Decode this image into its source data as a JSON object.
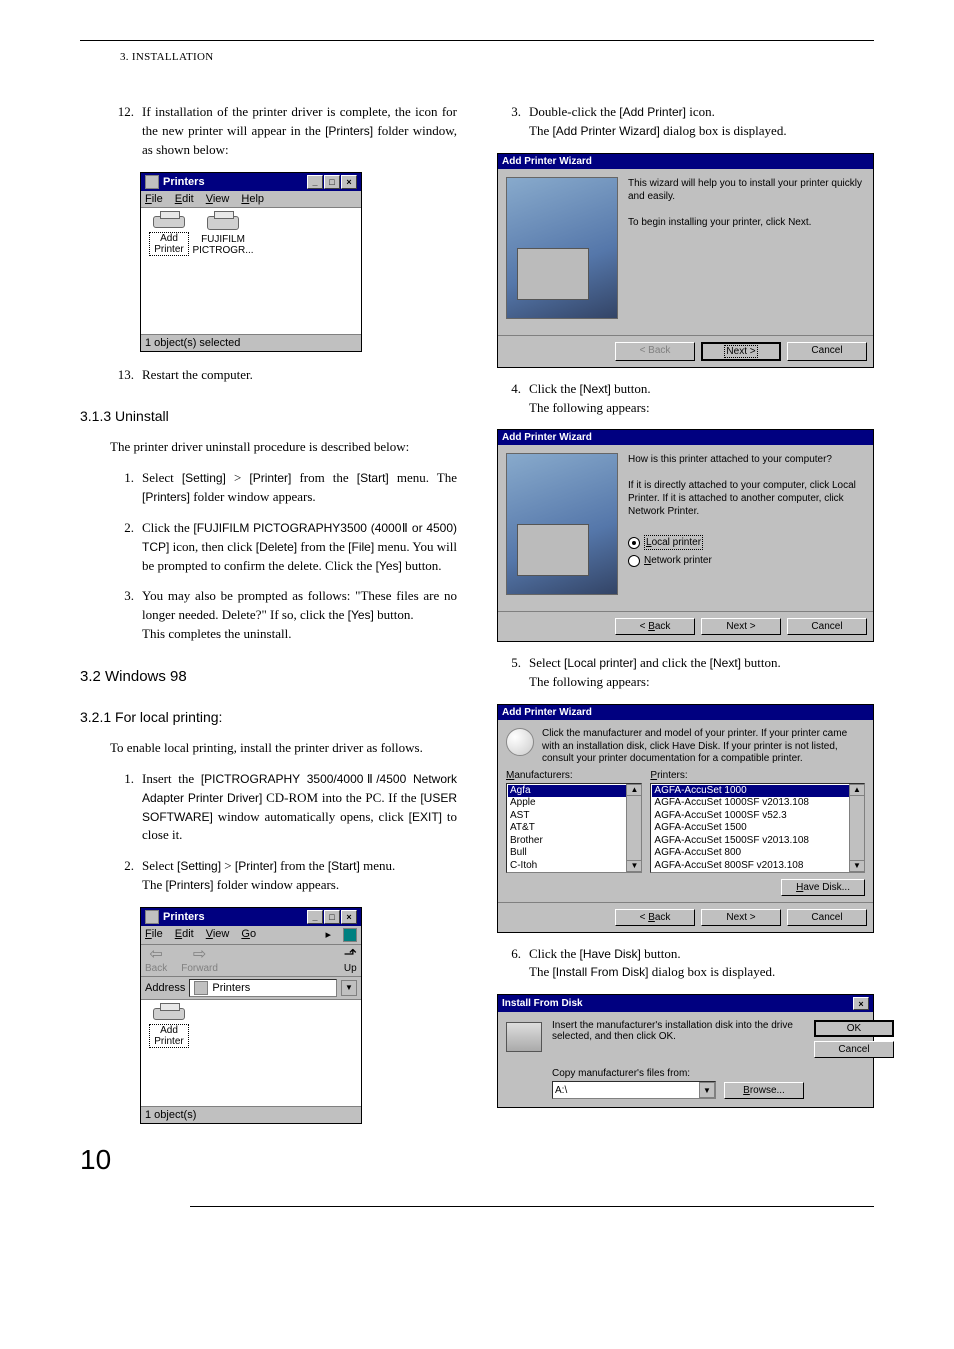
{
  "header": {
    "section": "3. INSTALLATION"
  },
  "left": {
    "step12_num": "12.",
    "step12_text_a": "If installation of the printer driver is complete, the icon for the new printer will appear in the ",
    "step12_ui": "[Printers]",
    "step12_text_b": " folder window, as shown below:",
    "printersWin": {
      "title": "Printers",
      "menu_file": "File",
      "menu_edit": "Edit",
      "menu_view": "View",
      "menu_help": "Help",
      "icon_add": "Add Printer",
      "icon_fuji": "FUJIFILM PICTROGR...",
      "status": "1 object(s) selected"
    },
    "step13_num": "13.",
    "step13_text": "Restart the computer.",
    "sec313": "3.1.3   Uninstall",
    "uninstall_intro": "The printer driver uninstall procedure is described below:",
    "u1_num": "1.",
    "u1_a": "Select ",
    "u1_ui1": "[Setting]",
    "u1_b": " > ",
    "u1_ui2": "[Printer]",
    "u1_c": " from the ",
    "u1_ui3": "[Start]",
    "u1_d": " menu. The ",
    "u1_ui4": "[Printers]",
    "u1_e": " folder window appears.",
    "u2_num": "2.",
    "u2_a": "Click the ",
    "u2_ui1": "[FUJIFILM PICTOGRAPHY3500 (4000Ⅱ or 4500) TCP]",
    "u2_b": " icon, then click ",
    "u2_ui2": "[Delete]",
    "u2_c": " from the ",
    "u2_ui3": "[File]",
    "u2_d": " menu. You will be prompted to confirm the delete. Click the ",
    "u2_ui4": "[Yes]",
    "u2_e": " button.",
    "u3_num": "3.",
    "u3_a": "You may also be prompted as follows: \"These files are no longer needed. Delete?\" If so, click the ",
    "u3_ui1": "[Yes]",
    "u3_b": " button.",
    "u3_c": "This completes the uninstall.",
    "sec32": "3.2   Windows 98",
    "sec321": "3.2.1   For local printing:",
    "local_intro": "To enable local printing, install the printer driver as follows.",
    "l1_num": "1.",
    "l1_a": "Insert the ",
    "l1_ui1": "[PICTROGRAPHY 3500/4000Ⅱ/4500 Network Adapter Printer Driver]",
    "l1_b": " CD-ROM into the PC. If the ",
    "l1_ui2": "[USER SOFTWARE]",
    "l1_c": " window automatically opens, click ",
    "l1_ui3": "[EXIT]",
    "l1_d": " to close it.",
    "l2_num": "2.",
    "l2_a": "Select ",
    "l2_ui1": "[Setting]",
    "l2_b": " > ",
    "l2_ui2": "[Printer]",
    "l2_c": " from the ",
    "l2_ui3": "[Start]",
    "l2_d": " menu.",
    "l2_e": "The ",
    "l2_ui4": "[Printers]",
    "l2_f": " folder window appears.",
    "printers98": {
      "title": "Printers",
      "menu_file": "File",
      "menu_edit": "Edit",
      "menu_view": "View",
      "menu_go": "Go",
      "tb_back": "Back",
      "tb_forward": "Forward",
      "tb_up": "Up",
      "addr_label": "Address",
      "addr_val": "Printers",
      "icon_add": "Add Printer",
      "status": "1 object(s)"
    }
  },
  "right": {
    "r3_num": "3.",
    "r3_a": "Double-click the ",
    "r3_ui1": "[Add Printer]",
    "r3_b": " icon.",
    "r3_c": "The ",
    "r3_ui2": "[Add Printer Wizard]",
    "r3_d": " dialog box is displayed.",
    "wiz1": {
      "title": "Add Printer Wizard",
      "line1": "This wizard will help you to install your printer quickly and easily.",
      "line2": "To begin installing your printer, click Next.",
      "back": "< Back",
      "next": "Next >",
      "cancel": "Cancel"
    },
    "r4_num": "4.",
    "r4_a": "Click the ",
    "r4_ui1": "[Next]",
    "r4_b": " button.",
    "r4_c": "The following appears:",
    "wiz2": {
      "title": "Add Printer Wizard",
      "q": "How is this printer attached to your computer?",
      "hint": "If it is directly attached to your computer, click Local Printer. If it is attached to another computer, click Network Printer.",
      "opt1": "Local printer",
      "opt2": "Network printer",
      "back": "< Back",
      "next": "Next >",
      "cancel": "Cancel"
    },
    "r5_num": "5.",
    "r5_a": "Select ",
    "r5_ui1": "[Local printer]",
    "r5_b": " and click the ",
    "r5_ui2": "[Next]",
    "r5_c": " button.",
    "r5_d": "The following appears:",
    "wiz3": {
      "title": "Add Printer Wizard",
      "instr": "Click the manufacturer and model of your printer. If your printer came with an installation disk, click Have Disk. If your printer is not listed, consult your printer documentation for a compatible printer.",
      "man_label": "Manufacturers:",
      "prn_label": "Printers:",
      "manufacturers": [
        "Agfa",
        "Apple",
        "AST",
        "AT&T",
        "Brother",
        "Bull",
        "C-Itoh"
      ],
      "printers": [
        "AGFA-AccuSet 1000",
        "AGFA-AccuSet 1000SF v2013.108",
        "AGFA-AccuSet 1000SF v52.3",
        "AGFA-AccuSet 1500",
        "AGFA-AccuSet 1500SF v2013.108",
        "AGFA-AccuSet 800",
        "AGFA-AccuSet 800SF v2013.108"
      ],
      "have": "Have Disk...",
      "back": "< Back",
      "next": "Next >",
      "cancel": "Cancel"
    },
    "r6_num": "6.",
    "r6_a": "Click the ",
    "r6_ui1": "[Have Disk]",
    "r6_b": " button.",
    "r6_c": "The ",
    "r6_ui2": "[Install From Disk]",
    "r6_d": " dialog box is displayed.",
    "ifd": {
      "title": "Install From Disk",
      "msg": "Insert the manufacturer's installation disk into the drive selected, and then click OK.",
      "copy": "Copy manufacturer's files from:",
      "drive": "A:\\",
      "ok": "OK",
      "cancel": "Cancel",
      "browse": "Browse..."
    }
  },
  "page_number": "10"
}
